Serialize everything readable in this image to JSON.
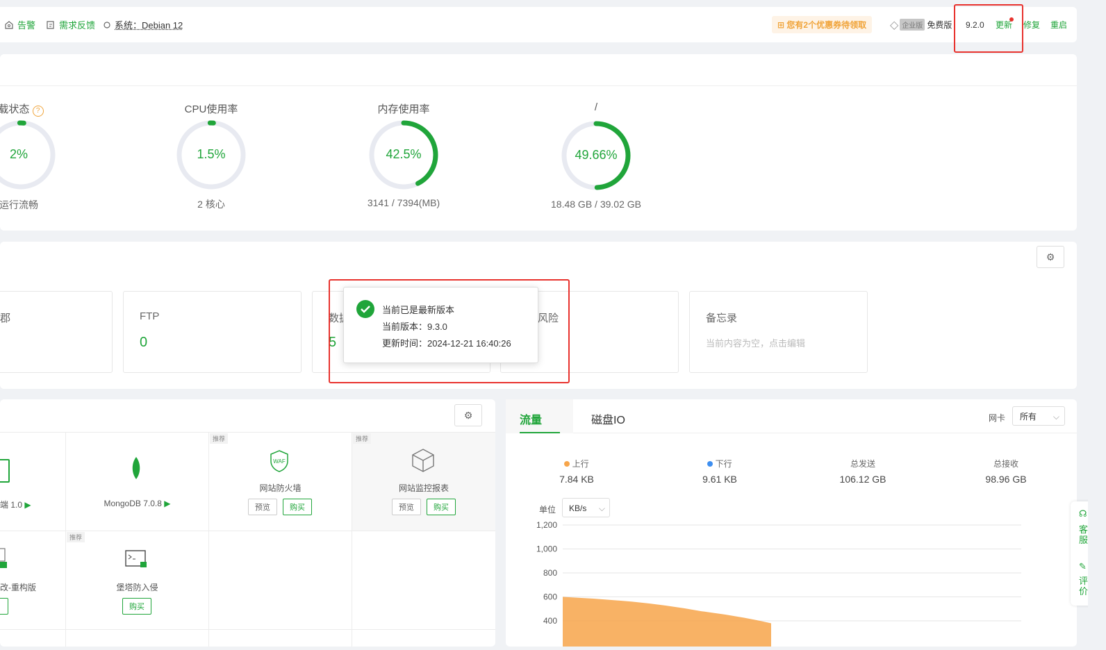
{
  "header": {
    "alert": "告警",
    "feedback": "需求反馈",
    "system": "系统：Debian 12",
    "coupon": "您有2个优惠券待领取",
    "edition_badge": "企业版",
    "edition": "免费版",
    "version": "9.2.0",
    "update": "更新",
    "repair": "修复",
    "restart": "重启"
  },
  "status": {
    "gauges": [
      {
        "title": "载状态",
        "value": "2%",
        "sub": "运行流畅",
        "percent": 2
      },
      {
        "title": "CPU使用率",
        "value": "1.5%",
        "sub": "2 核心",
        "percent": 1.5
      },
      {
        "title": "内存使用率",
        "value": "42.5%",
        "sub": "3141 / 7394(MB)",
        "percent": 42.5
      },
      {
        "title": "/",
        "value": "49.66%",
        "sub": "18.48 GB / 39.02 GB",
        "percent": 49.66
      }
    ],
    "help_icon": "question-icon"
  },
  "overview": {
    "boxes": [
      {
        "label": "郡",
        "value": ""
      },
      {
        "label": "FTP",
        "value": "0"
      },
      {
        "label": "数据",
        "value": "5"
      },
      {
        "label": "风险",
        "value": ""
      },
      {
        "label": "备忘录",
        "value": "当前内容为空，点击编辑"
      }
    ]
  },
  "popup": {
    "title": "当前已是最新版本",
    "version": "当前版本：9.3.0",
    "time": "更新时间：2024-12-21 16:40:26"
  },
  "software": {
    "items": [
      {
        "name": "端 1.0",
        "tag": ""
      },
      {
        "name": "MongoDB 7.0.8",
        "tag": ""
      },
      {
        "name": "网站防火墙",
        "tag": "推荐",
        "preview": "预览",
        "buy": "购买"
      },
      {
        "name": "网站监控报表",
        "tag": "推荐",
        "preview": "预览",
        "buy": "购买"
      },
      {
        "name": "改-重构版",
        "tag": ""
      },
      {
        "name": "堡塔防入侵",
        "tag": "推荐",
        "buy": "购买"
      }
    ]
  },
  "traffic": {
    "tabs": [
      "流量",
      "磁盘IO"
    ],
    "nic_label": "网卡",
    "nic_value": "所有",
    "stats": [
      {
        "label": "上行",
        "value": "7.84 KB",
        "color": "#f7a54a"
      },
      {
        "label": "下行",
        "value": "9.61 KB",
        "color": "#3d8ef0"
      },
      {
        "label": "总发送",
        "value": "106.12 GB"
      },
      {
        "label": "总接收",
        "value": "98.96 GB"
      }
    ],
    "unit_label": "单位",
    "unit_value": "KB/s"
  },
  "chart_data": {
    "type": "area",
    "y_ticks": [
      "1,200",
      "1,000",
      "800",
      "600",
      "400"
    ],
    "ylim": [
      400,
      1200
    ],
    "series": [
      {
        "name": "上行",
        "color": "#f7a54a",
        "x": [
          0,
          1,
          2,
          3
        ],
        "y": [
          600,
          560,
          480,
          380
        ]
      }
    ]
  },
  "float": {
    "service": "客服",
    "review": "评价"
  }
}
